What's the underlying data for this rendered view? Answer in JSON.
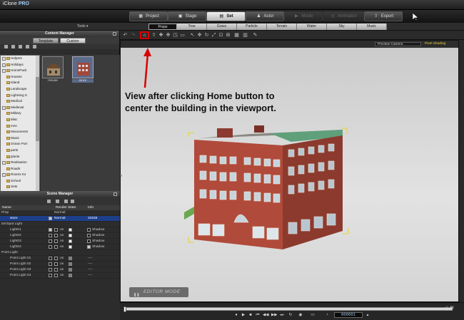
{
  "app": {
    "name": "iClone",
    "edition": "PRO"
  },
  "main_tabs": [
    {
      "label": "Project",
      "icon": "project-icon",
      "state": "normal"
    },
    {
      "label": "Stage",
      "icon": "stage-icon",
      "state": "normal"
    },
    {
      "label": "Set",
      "icon": "set-icon",
      "state": "active"
    },
    {
      "label": "Actor",
      "icon": "actor-icon",
      "state": "normal"
    },
    {
      "label": "Movie",
      "icon": "movie-icon",
      "state": "disabled"
    },
    {
      "label": "Animation",
      "icon": "animation-icon",
      "state": "disabled"
    },
    {
      "label": "Export",
      "icon": "export-icon",
      "state": "normal"
    }
  ],
  "sub_tabs": {
    "tools_label": "Tools ▾",
    "items": [
      "Props",
      "Tree",
      "Grass",
      "Particle",
      "Terrain",
      "Water",
      "Sky",
      "Music"
    ],
    "active": "Props"
  },
  "content_manager": {
    "title": "Content Manager",
    "tabs": [
      "Template",
      "Custom"
    ],
    "active_tab": "Custom",
    "tree": [
      {
        "label": "Helpers",
        "expander": "+",
        "indent": 0
      },
      {
        "label": "Holidays",
        "expander": "+",
        "indent": 0
      },
      {
        "label": "HomePack",
        "expander": "+",
        "indent": 0
      },
      {
        "label": "Houses",
        "expander": "",
        "indent": 0
      },
      {
        "label": "Island",
        "expander": "",
        "indent": 0
      },
      {
        "label": "Landscape",
        "expander": "",
        "indent": 0
      },
      {
        "label": "Lightning S",
        "expander": "",
        "indent": 0
      },
      {
        "label": "Medical",
        "expander": "",
        "indent": 0
      },
      {
        "label": "Medieval",
        "expander": "+",
        "indent": 0
      },
      {
        "label": "Military",
        "expander": "",
        "indent": 0
      },
      {
        "label": "Misc",
        "expander": "",
        "indent": 0
      },
      {
        "label": "mnn",
        "expander": "",
        "indent": 0
      },
      {
        "label": "Monuments",
        "expander": "",
        "indent": 0
      },
      {
        "label": "Music",
        "expander": "",
        "indent": 0
      },
      {
        "label": "Ocean Port",
        "expander": "",
        "indent": 0
      },
      {
        "label": "parts",
        "expander": "",
        "indent": 0
      },
      {
        "label": "plants",
        "expander": "",
        "indent": 0
      },
      {
        "label": "Realisation",
        "expander": "+",
        "indent": 0
      },
      {
        "label": "Roads",
        "expander": "",
        "indent": 0
      },
      {
        "label": "Rooms Int",
        "expander": "+",
        "indent": 0
      },
      {
        "label": "School",
        "expander": "",
        "indent": 0
      },
      {
        "label": "Sets",
        "expander": "",
        "indent": 0
      },
      {
        "label": "sketchup",
        "expander": "−",
        "indent": 0
      },
      {
        "label": "building",
        "expander": "",
        "indent": 1
      },
      {
        "label": "Skies",
        "expander": "",
        "indent": 0
      }
    ],
    "thumbnails": [
      {
        "label": "House",
        "selected": false
      },
      {
        "label": "store",
        "selected": true
      }
    ]
  },
  "scene_manager": {
    "title": "Scene Manager",
    "columns": [
      "Name",
      "Render State",
      "Info"
    ],
    "rows": [
      {
        "name": "Prop",
        "group": true,
        "render": "Normal",
        "info": "",
        "checked": true
      },
      {
        "name": "store",
        "group": false,
        "render": "Normal",
        "info": "23226",
        "checked": true,
        "selected": true
      },
      {
        "name": "Dir/Spot Light",
        "group": true,
        "render": "",
        "info": ""
      },
      {
        "name": "Light01",
        "group": false,
        "on": "on",
        "shadow": "Shadow",
        "checked": true,
        "shadow_checked": false
      },
      {
        "name": "Light02",
        "group": false,
        "on": "on",
        "shadow": "Shadow",
        "checked": false,
        "shadow_checked": false
      },
      {
        "name": "Light03",
        "group": false,
        "on": "on",
        "shadow": "Shadow",
        "checked": false,
        "shadow_checked": false
      },
      {
        "name": "Light04",
        "group": false,
        "on": "on",
        "shadow": "Shadow",
        "checked": false,
        "shadow_checked": true
      },
      {
        "name": "Point Light",
        "group": true,
        "render": "",
        "info": ""
      },
      {
        "name": "Point Light 01",
        "group": false,
        "on": "on",
        "info": "----"
      },
      {
        "name": "Point Light 02",
        "group": false,
        "on": "on",
        "info": "----"
      },
      {
        "name": "Point Light 03",
        "group": false,
        "on": "on",
        "info": "----"
      },
      {
        "name": "Point Light 04",
        "group": false,
        "on": "on",
        "info": "----"
      }
    ]
  },
  "viewport": {
    "camera": "Preview Camera",
    "shading": "Pixel Shading",
    "annotation_line1": "View after clicking Home button to",
    "annotation_line2": "center the building in the viewport.",
    "editor_mode": "EDITOR MODE",
    "highlight_color": "#d80000"
  },
  "timeline": {
    "frame": "000001",
    "progress": 0
  },
  "colors": {
    "selected_row": "#1d3f8a",
    "annotation": "#d80000",
    "shading_text": "#e8d23a"
  }
}
